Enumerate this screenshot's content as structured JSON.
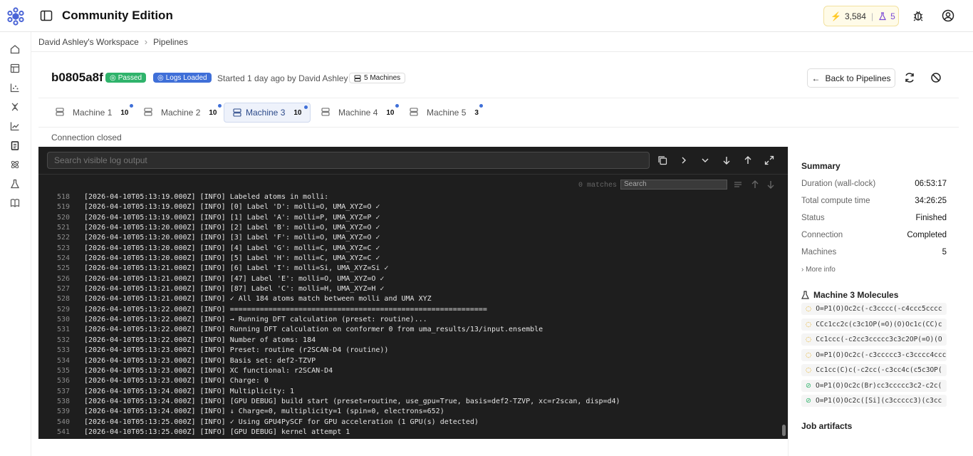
{
  "app": {
    "title": "Community Edition"
  },
  "credits": {
    "value": "3,584",
    "count": "5"
  },
  "breadcrumb": {
    "workspace": "David Ashley's Workspace",
    "current": "Pipelines"
  },
  "job": {
    "id": "b0805a8f",
    "status_badge": "Passed",
    "logs_badge": "Logs Loaded",
    "started": "Started 1 day ago by David Ashley",
    "machines_badge": "5 Machines",
    "back_label": "Back to Pipelines"
  },
  "tabs": [
    {
      "label": "Machine 1",
      "count": "10"
    },
    {
      "label": "Machine 2",
      "count": "10"
    },
    {
      "label": "Machine 3",
      "count": "10"
    },
    {
      "label": "Machine 4",
      "count": "10"
    },
    {
      "label": "Machine 5",
      "count": "3"
    }
  ],
  "connection_status": "Connection closed",
  "log": {
    "search_placeholder": "Search visible log output",
    "matches": "0 matches",
    "find_placeholder": "Search",
    "lines": [
      {
        "n": "518",
        "t": "[2026-04-10T05:13:19.000Z] [INFO] Labeled atoms in molli:"
      },
      {
        "n": "519",
        "t": "[2026-04-10T05:13:19.000Z] [INFO] [0] Label 'D': molli=O, UMA_XYZ=O ✓"
      },
      {
        "n": "520",
        "t": "[2026-04-10T05:13:19.000Z] [INFO] [1] Label 'A': molli=P, UMA_XYZ=P ✓"
      },
      {
        "n": "521",
        "t": "[2026-04-10T05:13:20.000Z] [INFO] [2] Label 'B': molli=O, UMA_XYZ=O ✓"
      },
      {
        "n": "522",
        "t": "[2026-04-10T05:13:20.000Z] [INFO] [3] Label 'F': molli=O, UMA_XYZ=O ✓"
      },
      {
        "n": "523",
        "t": "[2026-04-10T05:13:20.000Z] [INFO] [4] Label 'G': molli=C, UMA_XYZ=C ✓"
      },
      {
        "n": "524",
        "t": "[2026-04-10T05:13:20.000Z] [INFO] [5] Label 'H': molli=C, UMA_XYZ=C ✓"
      },
      {
        "n": "525",
        "t": "[2026-04-10T05:13:21.000Z] [INFO] [6] Label 'I': molli=Si, UMA_XYZ=Si ✓"
      },
      {
        "n": "526",
        "t": "[2026-04-10T05:13:21.000Z] [INFO] [47] Label 'E': molli=O, UMA_XYZ=O ✓"
      },
      {
        "n": "527",
        "t": "[2026-04-10T05:13:21.000Z] [INFO] [87] Label 'C': molli=H, UMA_XYZ=H ✓"
      },
      {
        "n": "528",
        "t": "[2026-04-10T05:13:21.000Z] [INFO] ✓ All 184 atoms match between molli and UMA XYZ"
      },
      {
        "n": "529",
        "t": "[2026-04-10T05:13:22.000Z] [INFO] ============================================================"
      },
      {
        "n": "530",
        "t": "[2026-04-10T05:13:22.000Z] [INFO] → Running DFT calculation (preset: routine)..."
      },
      {
        "n": "531",
        "t": "[2026-04-10T05:13:22.000Z] [INFO] Running DFT calculation on conformer 0 from uma_results/13/input.ensemble"
      },
      {
        "n": "532",
        "t": "[2026-04-10T05:13:22.000Z] [INFO] Number of atoms: 184"
      },
      {
        "n": "533",
        "t": "[2026-04-10T05:13:23.000Z] [INFO] Preset: routine (r2SCAN-D4 (routine))"
      },
      {
        "n": "534",
        "t": "[2026-04-10T05:13:23.000Z] [INFO] Basis set: def2-TZVP"
      },
      {
        "n": "535",
        "t": "[2026-04-10T05:13:23.000Z] [INFO] XC functional: r2SCAN-D4"
      },
      {
        "n": "536",
        "t": "[2026-04-10T05:13:23.000Z] [INFO] Charge: 0"
      },
      {
        "n": "537",
        "t": "[2026-04-10T05:13:24.000Z] [INFO] Multiplicity: 1"
      },
      {
        "n": "538",
        "t": "[2026-04-10T05:13:24.000Z] [INFO] [GPU DEBUG] build start (preset=routine, use_gpu=True, basis=def2-TZVP, xc=r2scan, disp=d4)"
      },
      {
        "n": "539",
        "t": "[2026-04-10T05:13:24.000Z] [INFO] ↓ Charge=0, multiplicity=1 (spin=0, electrons=652)"
      },
      {
        "n": "540",
        "t": "[2026-04-10T05:13:25.000Z] [INFO] ✓ Using GPU4PySCF for GPU acceleration (1 GPU(s) detected)"
      },
      {
        "n": "541",
        "t": "[2026-04-10T05:13:25.000Z] [INFO] [GPU DEBUG] kernel attempt 1"
      }
    ]
  },
  "summary": {
    "title": "Summary",
    "rows": [
      {
        "k": "Duration (wall-clock)",
        "v": "06:53:17"
      },
      {
        "k": "Total compute time",
        "v": "34:26:25"
      },
      {
        "k": "Status",
        "v": "Finished"
      },
      {
        "k": "Connection",
        "v": "Completed"
      },
      {
        "k": "Machines",
        "v": "5"
      }
    ],
    "more_info": "More info",
    "molecules_title": "Machine 3 Molecules",
    "molecules": [
      {
        "smiles": "O=P1(O)Oc2c(-c3cccc(-c4ccc5cccc",
        "state": "pending"
      },
      {
        "smiles": "CCc1cc2c(c3c1OP(=O)(O)Oc1c(CC)c",
        "state": "pending"
      },
      {
        "smiles": "Cc1ccc(-c2cc3ccccc3c3c2OP(=O)(O",
        "state": "pending"
      },
      {
        "smiles": "O=P1(O)Oc2c(-c3ccccc3-c3cccc4ccc",
        "state": "pending"
      },
      {
        "smiles": "Cc1cc(C)c(-c2cc(-c3cc4c(c5c3OP(",
        "state": "pending"
      },
      {
        "smiles": "O=P1(O)Oc2c(Br)cc3ccccc3c2-c2c(",
        "state": "done"
      },
      {
        "smiles": "O=P1(O)Oc2c([Si](c3ccccc3)(c3cc",
        "state": "done"
      }
    ],
    "artifacts_title": "Job artifacts"
  },
  "colors": {
    "accent": "#3f6fd8",
    "success": "#2fb36b",
    "log_bg": "#1e1e1e"
  }
}
